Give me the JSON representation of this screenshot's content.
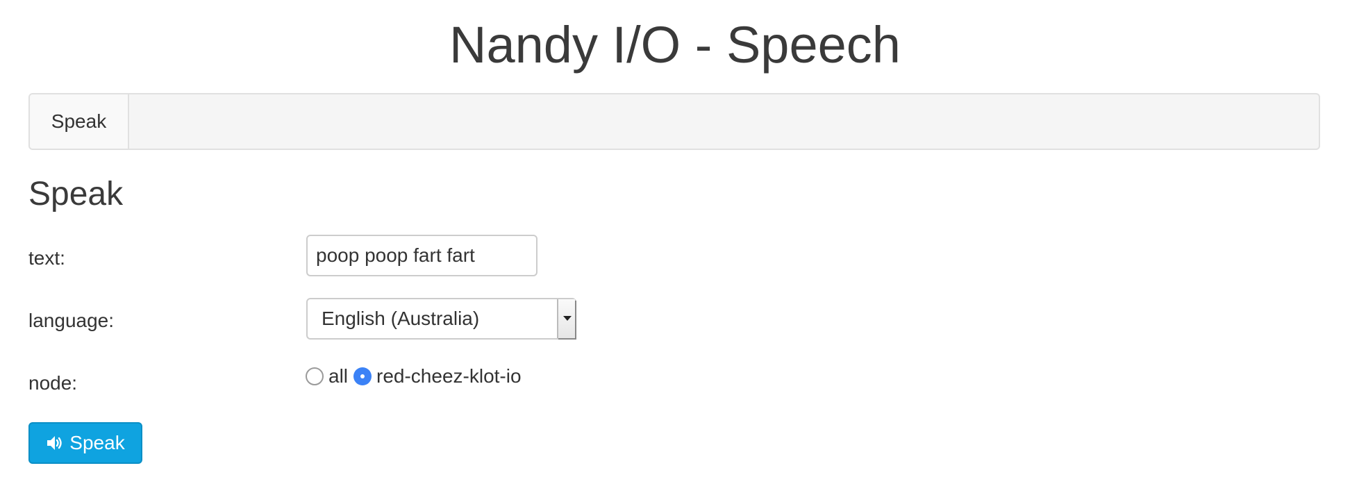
{
  "app": {
    "title": "Nandy I/O - Speech"
  },
  "tabs": [
    {
      "label": "Speak",
      "active": true
    }
  ],
  "section": {
    "heading": "Speak"
  },
  "form": {
    "text_label": "text:",
    "text_value": "poop poop fart fart",
    "language_label": "language:",
    "language_selected": "English (Australia)",
    "node_label": "node:",
    "node_options": [
      {
        "label": "all",
        "checked": false
      },
      {
        "label": "red-cheez-klot-io",
        "checked": true
      }
    ]
  },
  "actions": {
    "speak_label": "Speak",
    "speak_icon": "volume-up-icon"
  },
  "colors": {
    "accent": "#0fa3e0",
    "radio_checked": "#3b82f6",
    "text": "#333333"
  }
}
